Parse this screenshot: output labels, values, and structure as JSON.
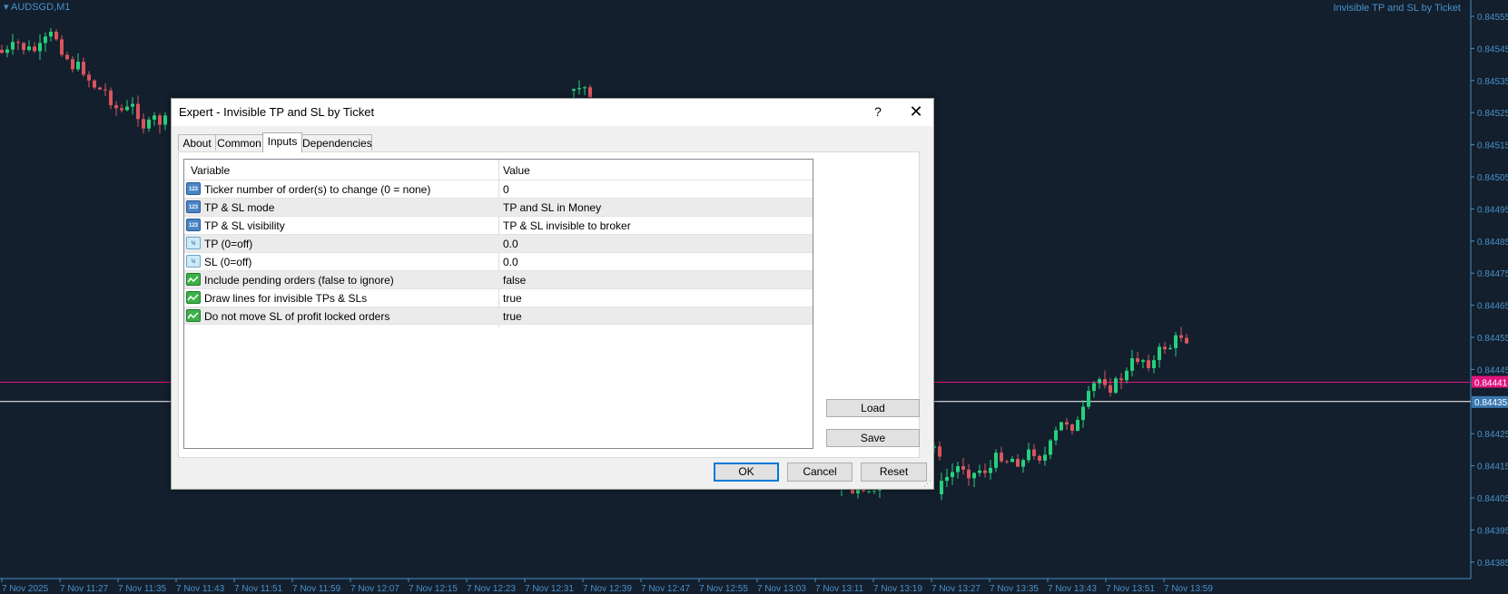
{
  "chart": {
    "symbol": "AUDSGD,M1",
    "ea_name": "Invisible TP and SL by Ticket",
    "price_labels": [
      "0.84555",
      "0.84545",
      "0.84535",
      "0.84525",
      "0.84515",
      "0.84505",
      "0.84495",
      "0.84485",
      "0.84475",
      "0.84465",
      "0.84455",
      "0.84445",
      "0.84425",
      "0.84415",
      "0.84405",
      "0.84395",
      "0.84385"
    ],
    "current_bid": "0.84435",
    "line_price": "0.84441",
    "time_labels": [
      "7 Nov 2025",
      "7 Nov 11:27",
      "7 Nov 11:35",
      "7 Nov 11:43",
      "7 Nov 11:51",
      "7 Nov 11:59",
      "7 Nov 12:07",
      "7 Nov 12:15",
      "7 Nov 12:23",
      "7 Nov 12:31",
      "7 Nov 12:39",
      "7 Nov 12:47",
      "7 Nov 12:55",
      "7 Nov 13:03",
      "7 Nov 13:11",
      "7 Nov 13:19",
      "7 Nov 13:27",
      "7 Nov 13:35",
      "7 Nov 13:43",
      "7 Nov 13:51",
      "7 Nov 13:59"
    ],
    "colors": {
      "background": "#131f2d",
      "bull": "#26d07c",
      "bear": "#d9555e",
      "axis_text": "#4a90c8",
      "line_magenta": "#e0137e",
      "line_white": "#ffffff"
    }
  },
  "dialog": {
    "title": "Expert - Invisible TP and SL by Ticket",
    "help": "?",
    "close": "✕",
    "tabs": [
      "About",
      "Common",
      "Inputs",
      "Dependencies"
    ],
    "active_tab": "Inputs",
    "columns": {
      "variable": "Variable",
      "value": "Value"
    },
    "rows": [
      {
        "type": "int",
        "icon_text": "123",
        "variable": "Ticker number of order(s) to change (0 = none)",
        "value": "0"
      },
      {
        "type": "int",
        "icon_text": "123",
        "variable": "TP & SL mode",
        "value": "TP and SL in Money"
      },
      {
        "type": "int",
        "icon_text": "123",
        "variable": "TP & SL visibility",
        "value": "TP & SL invisible to broker"
      },
      {
        "type": "double",
        "icon_text": "½",
        "variable": "TP (0=off)",
        "value": "0.0"
      },
      {
        "type": "double",
        "icon_text": "½",
        "variable": "SL (0=off)",
        "value": "0.0"
      },
      {
        "type": "bool",
        "icon_text": "",
        "variable": "Include pending orders (false to ignore)",
        "value": "false"
      },
      {
        "type": "bool",
        "icon_text": "",
        "variable": "Draw lines for invisible TPs & SLs",
        "value": "true"
      },
      {
        "type": "bool",
        "icon_text": "",
        "variable": "Do not move SL of profit locked orders",
        "value": "true"
      }
    ],
    "buttons": {
      "load": "Load",
      "save": "Save",
      "ok": "OK",
      "cancel": "Cancel",
      "reset": "Reset"
    }
  }
}
